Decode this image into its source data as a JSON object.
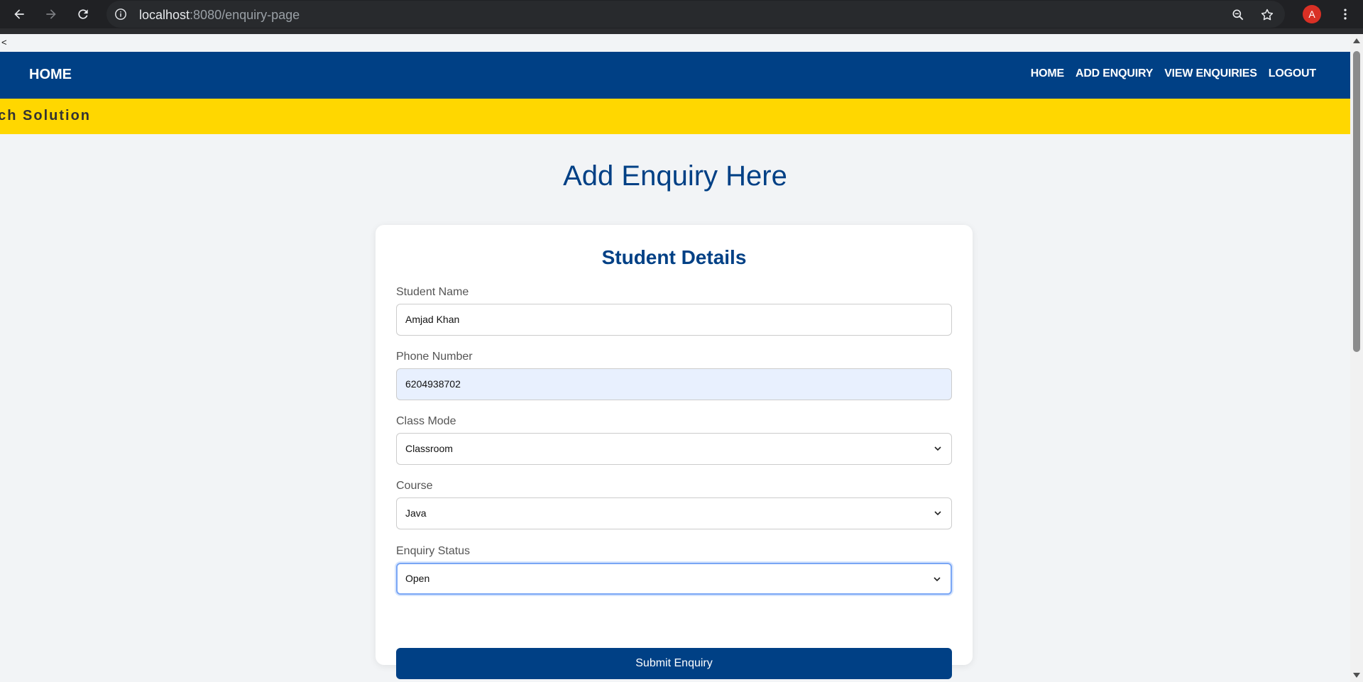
{
  "browser": {
    "url_host": "localhost",
    "url_path": ":8080/enquiry-page",
    "profile_initial": "A"
  },
  "page": {
    "stray_text": "<",
    "nav": {
      "brand": "HOME",
      "links": [
        "HOME",
        "ADD ENQUIRY",
        "VIEW ENQUIRIES",
        "LOGOUT"
      ]
    },
    "marquee": "ech Solution",
    "heading": "Add Enquiry Here",
    "form": {
      "title": "Student Details",
      "fields": [
        {
          "label": "Student Name",
          "value": "Amjad Khan"
        },
        {
          "label": "Phone Number",
          "value": "6204938702"
        },
        {
          "label": "Class Mode",
          "value": "Classroom"
        },
        {
          "label": "Course",
          "value": "Java"
        },
        {
          "label": "Enquiry Status",
          "value": "Open"
        }
      ],
      "submit_label": "Submit Enquiry"
    }
  },
  "colors": {
    "primary": "#004085",
    "banner": "#ffd700",
    "autofill": "#e8f0fe",
    "chrome": "#202124"
  },
  "icons": [
    "back-icon",
    "forward-icon",
    "reload-icon",
    "info-icon",
    "zoom-icon",
    "star-icon",
    "kebab-menu-icon",
    "chevron-down-icon"
  ]
}
